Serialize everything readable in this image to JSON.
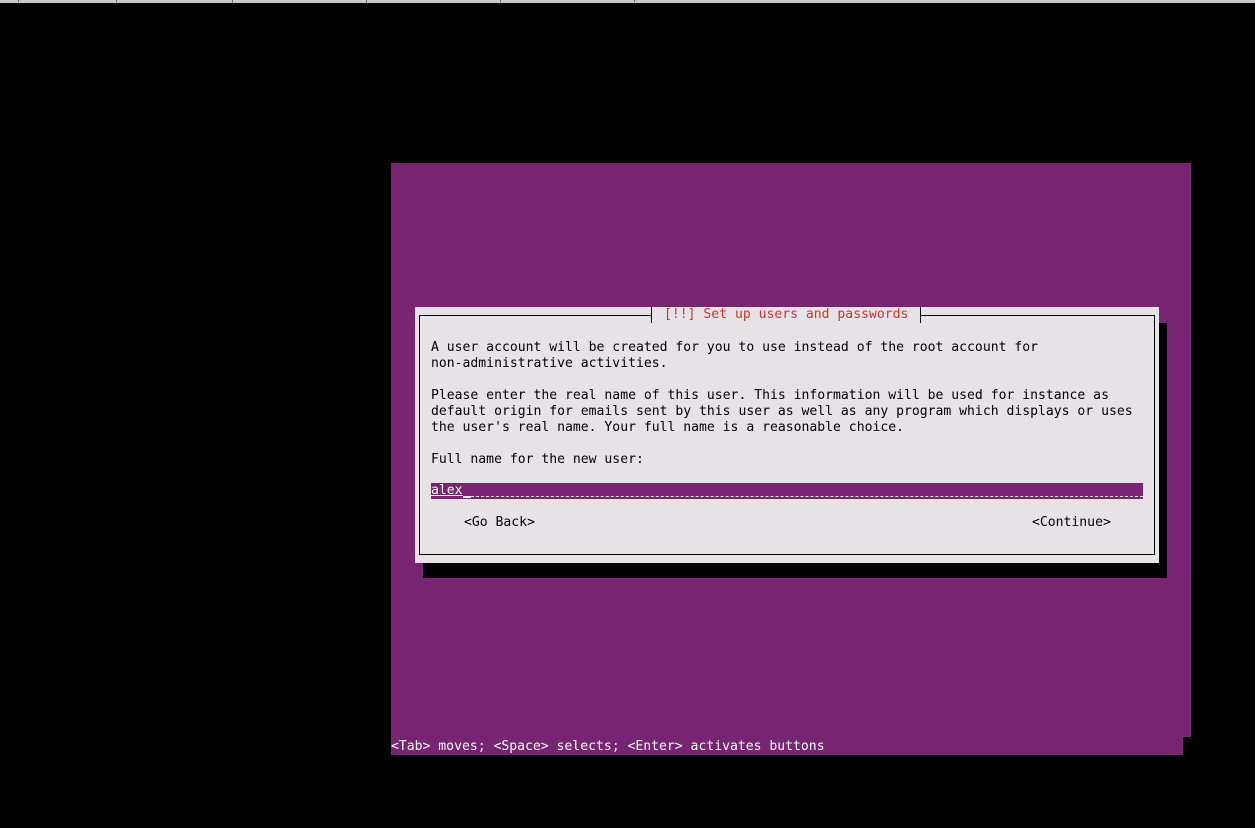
{
  "dialog": {
    "title": "[!!] Set up users and passwords",
    "intro_line1": "A user account will be created for you to use instead of the root account for",
    "intro_line2": "non-administrative activities.",
    "info_line1": "Please enter the real name of this user. This information will be used for instance as",
    "info_line2": "default origin for emails sent by this user as well as any program which displays or uses",
    "info_line3": "the user's real name. Your full name is a reasonable choice.",
    "field_label": "Full name for the new user:",
    "field_value": "alex",
    "go_back_label": "<Go Back>",
    "continue_label": "<Continue>"
  },
  "footer": {
    "help_text": "<Tab> moves; <Space> selects; <Enter> activates buttons"
  },
  "colors": {
    "background": "#000000",
    "screen_purple": "#772472",
    "dialog_bg": "#e6e2e5",
    "title_red": "#d4322a"
  }
}
